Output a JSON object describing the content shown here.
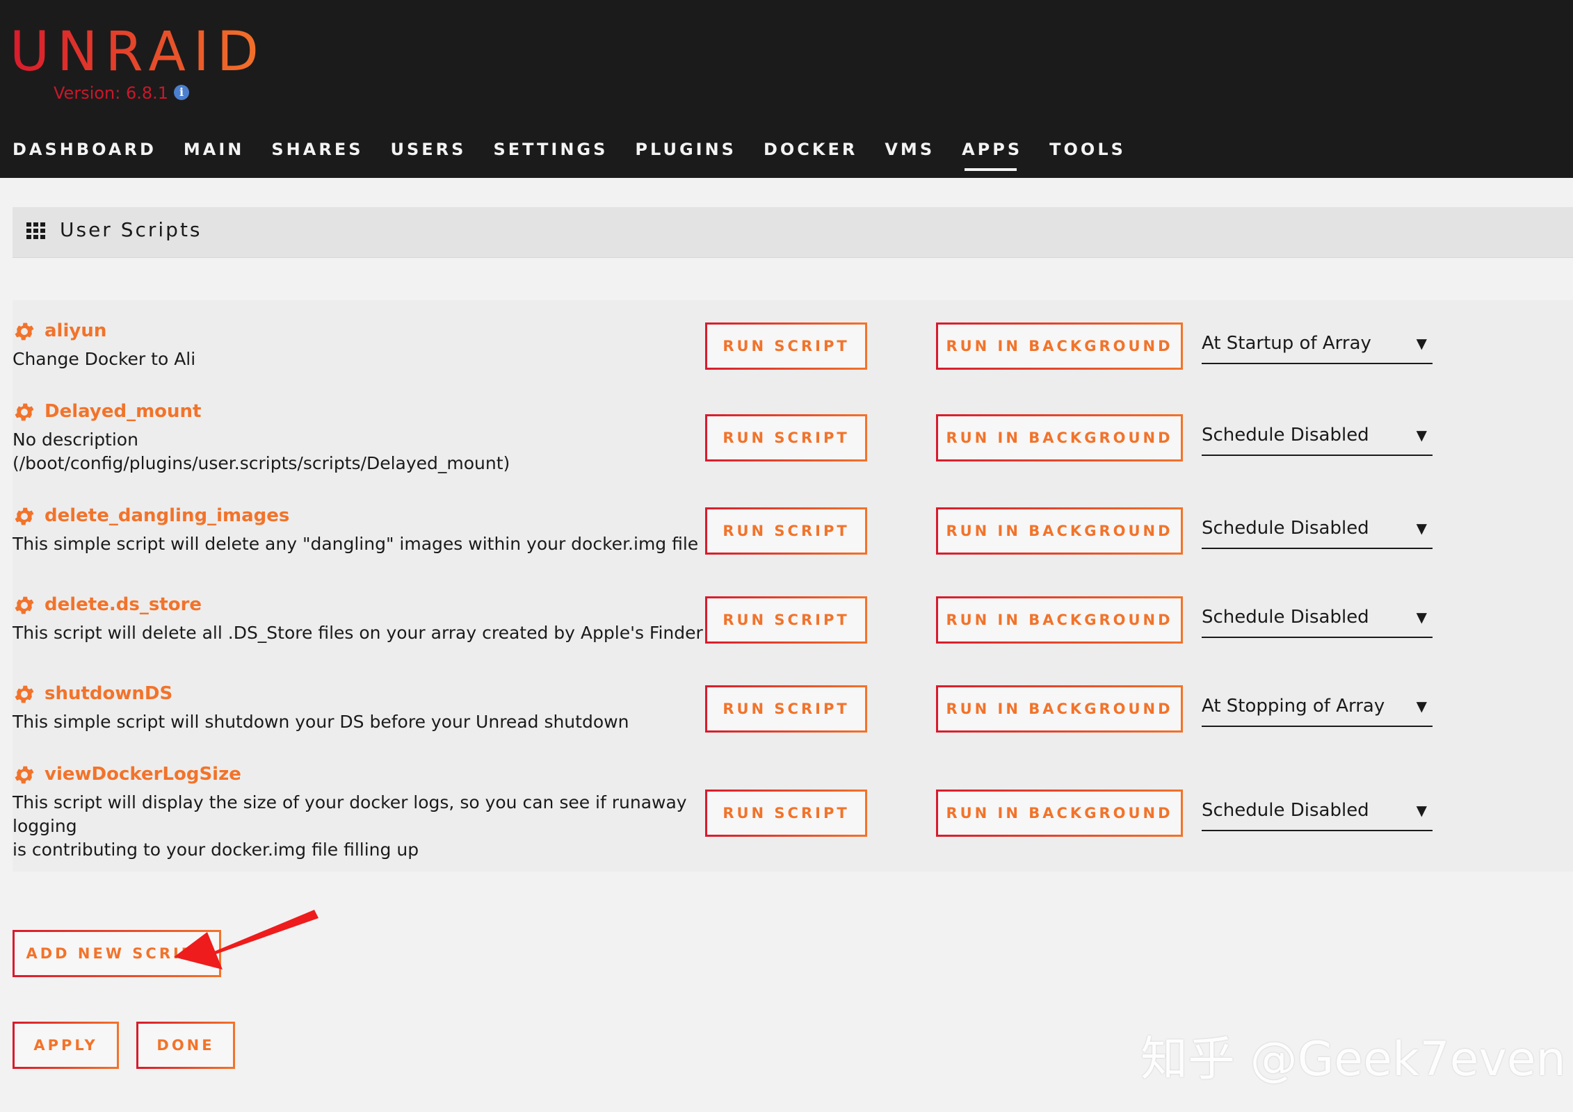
{
  "brand": {
    "logo": "UNRAID",
    "version": "Version: 6.8.1"
  },
  "nav": {
    "items": [
      "DASHBOARD",
      "MAIN",
      "SHARES",
      "USERS",
      "SETTINGS",
      "PLUGINS",
      "DOCKER",
      "VMS",
      "APPS",
      "TOOLS"
    ],
    "active": "APPS"
  },
  "section": {
    "title": "User Scripts"
  },
  "scripts": [
    {
      "name": "aliyun",
      "description": "Change Docker to Ali",
      "schedule": "At Startup of Array"
    },
    {
      "name": "Delayed_mount",
      "description": "No description\n(/boot/config/plugins/user.scripts/scripts/Delayed_mount)",
      "schedule": "Schedule Disabled"
    },
    {
      "name": "delete_dangling_images",
      "description": "This simple script will delete any \"dangling\" images within your docker.img file",
      "schedule": "Schedule Disabled"
    },
    {
      "name": "delete.ds_store",
      "description": "This script will delete all .DS_Store files on your array created by Apple's Finder",
      "schedule": "Schedule Disabled"
    },
    {
      "name": "shutdownDS",
      "description": "This simple script will shutdown your DS before your Unread shutdown",
      "schedule": "At Stopping of Array"
    },
    {
      "name": "viewDockerLogSize",
      "description": "This script will display the size of your docker logs, so you can see if runaway logging\nis contributing to your docker.img file filling up",
      "schedule": "Schedule Disabled"
    }
  ],
  "buttons": {
    "run_script": "RUN SCRIPT",
    "run_background": "RUN IN BACKGROUND",
    "add_new_script": "ADD NEW SCRIPT",
    "apply": "APPLY",
    "done": "DONE"
  },
  "watermark": "知乎 @Geek7even",
  "colors": {
    "accent": "#f2732a",
    "accent_red": "#d81b2c",
    "header_bg": "#1c1b1b",
    "annotation_arrow": "#ee1c1c"
  },
  "icons": {
    "info": "info-icon",
    "section": "grid-icon",
    "script": "gear-icon",
    "select": "caret-down-icon"
  }
}
